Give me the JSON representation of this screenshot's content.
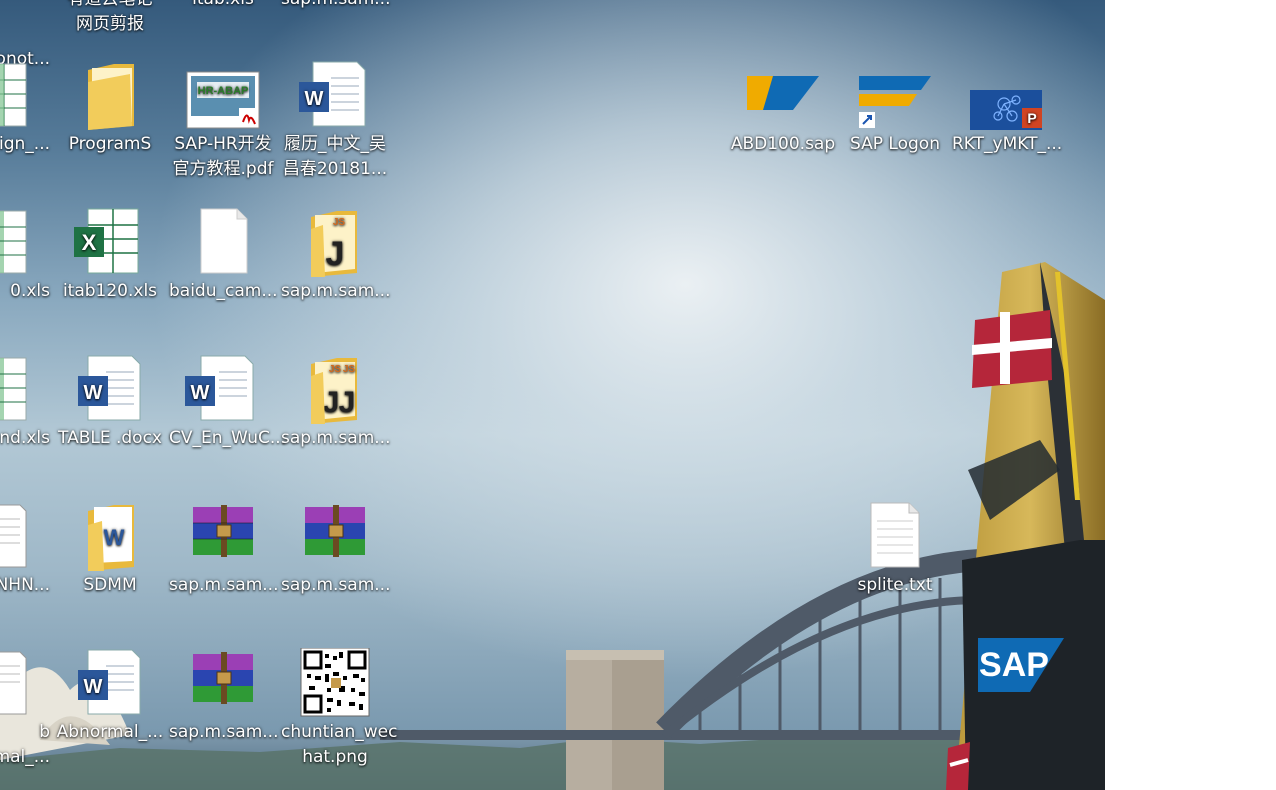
{
  "colors": {
    "sky_top": "#355a7c",
    "sky_haze": "#d6e2e9",
    "bridge_steel": "#4f5a68",
    "sail_gold": "#c9a642",
    "sap_blue": "#0f6ab4",
    "folder_yellow": "#f2cc5b",
    "excel_green": "#1f7244",
    "word_blue": "#2b579a",
    "winrar_purple": "#9b3fb5"
  },
  "desktop": {
    "wallpaper_text": {
      "sap_logo": "SAP"
    },
    "icons": [
      {
        "id": "c0r0",
        "label": "onot...",
        "type": "text-icon"
      },
      {
        "id": "c1r0",
        "label": "有道云笔记\n网页剪报",
        "type": "folder-icon"
      },
      {
        "id": "c2r0",
        "label": "itab.xls",
        "type": "excel-icon"
      },
      {
        "id": "c3r0",
        "label": "sap.m.sam...",
        "type": "js-folder-icon"
      },
      {
        "id": "c0r1",
        "label": "aign_...",
        "type": "excel-icon"
      },
      {
        "id": "c1r1",
        "label": "ProgramS",
        "type": "folder-icon"
      },
      {
        "id": "c2r1",
        "label": "SAP-HR开发\n官方教程.pdf",
        "type": "pdf-icon"
      },
      {
        "id": "c3r1",
        "label": "履历_中文_吴\n昌春20181...",
        "type": "word-icon"
      },
      {
        "id": "c0r2",
        "label": "0.xls",
        "type": "excel-icon"
      },
      {
        "id": "c1r2",
        "label": "itab120.xls",
        "type": "excel-icon"
      },
      {
        "id": "c2r2",
        "label": "baidu_cam...",
        "type": "blank-file-icon"
      },
      {
        "id": "c3r2",
        "label": "sap.m.sam...",
        "type": "js-folder-icon"
      },
      {
        "id": "c0r3",
        "label": "nd.xls",
        "type": "excel-icon"
      },
      {
        "id": "c1r3",
        "label": "TABLE .docx",
        "type": "word-icon"
      },
      {
        "id": "c2r3",
        "label": "CV_En_WuC...",
        "type": "word-icon"
      },
      {
        "id": "c3r3",
        "label": "sap.m.sam...",
        "type": "js-folder-icon"
      },
      {
        "id": "c0r4",
        "label": "NHN...",
        "type": "text-icon"
      },
      {
        "id": "c1r4",
        "label": "SDMM",
        "type": "word-folder-icon"
      },
      {
        "id": "c2r4",
        "label": "sap.m.sam...",
        "type": "winrar-icon"
      },
      {
        "id": "c3r4",
        "label": "sap.m.sam...",
        "type": "winrar-icon"
      },
      {
        "id": "c0r5",
        "label": "b\nmal_...",
        "type": "text-icon"
      },
      {
        "id": "c1r5",
        "label": "Abnormal_...",
        "type": "word-icon"
      },
      {
        "id": "c2r5",
        "label": "sap.m.sam...",
        "type": "winrar-icon"
      },
      {
        "id": "c3r5",
        "label": "chuntian_wec\nhat.png",
        "type": "qr-image-icon"
      },
      {
        "id": "abd100",
        "label": "ABD100.sap",
        "type": "sap-shortcut-icon"
      },
      {
        "id": "saplogon",
        "label": "SAP Logon",
        "type": "sap-logon-icon"
      },
      {
        "id": "rkt",
        "label": "RKT_yMKT_...",
        "type": "powerpoint-icon"
      },
      {
        "id": "splite",
        "label": "splite.txt",
        "type": "text-icon"
      }
    ]
  }
}
